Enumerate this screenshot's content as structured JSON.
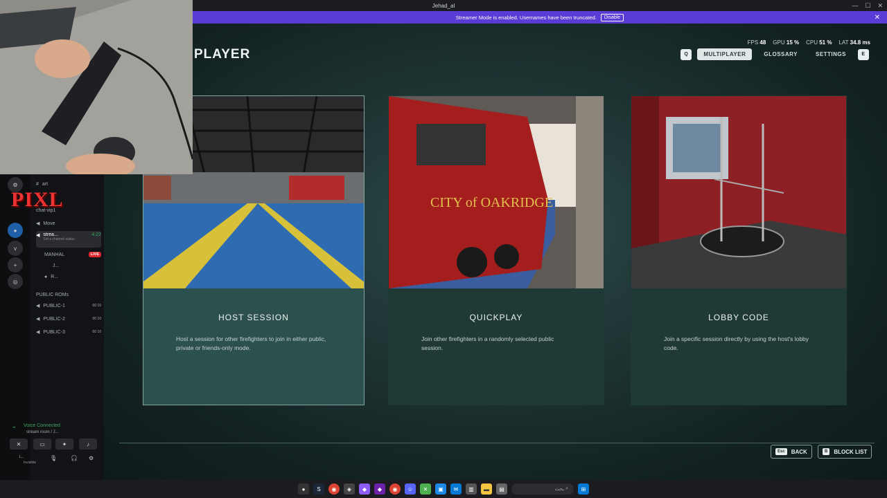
{
  "window": {
    "title": "Jehad_al"
  },
  "streamer_banner": {
    "text": "Streamer Mode is enabled. Usernames have been truncated.",
    "disable_label": "Disable",
    "close_label": "✕"
  },
  "game": {
    "title": "PLAYER",
    "stats": {
      "fps_label": "FPS",
      "fps": "48",
      "gpu_label": "GPU",
      "gpu": "15 %",
      "cpu_label": "CPU",
      "cpu": "51 %",
      "lat_label": "LAT",
      "lat": "34.8 ms"
    },
    "nav": {
      "left_key": "Q",
      "tabs": [
        "MULTIPLAYER",
        "GLOSSARY",
        "SETTINGS"
      ],
      "right_key": "E"
    },
    "cards": [
      {
        "title": "HOST SESSION",
        "desc": "Host a session for other firefighters to join in either public, private or friends-only mode."
      },
      {
        "title": "QUICKPLAY",
        "desc": "Join other firefighters in a randomly selected public session."
      },
      {
        "title": "LOBBY CODE",
        "desc": "Join a specific session directly by using the host's lobby code."
      }
    ],
    "bottom": {
      "back_key": "Esc",
      "back_label": "BACK",
      "block_key": "B",
      "block_label": "BLOCK LIST"
    }
  },
  "discord": {
    "logo_text": "PIXL",
    "channels": [
      {
        "icon": "#",
        "name": "art"
      },
      {
        "icon": "",
        "name": "chat-vip1"
      },
      {
        "icon": "🔊",
        "name": "Move"
      },
      {
        "icon": "🔊",
        "name": "strea...",
        "time": "4:22",
        "status": "Set a channel status"
      },
      {
        "icon": "",
        "name": "MANHAL",
        "badge": "LIVE"
      },
      {
        "icon": "",
        "name": "J..."
      },
      {
        "icon": "",
        "name": "R..."
      },
      {
        "icon": "",
        "name": "PUBLIC ROMs"
      },
      {
        "icon": "🔊",
        "name": "PUBLIC-1",
        "count": "00 10"
      },
      {
        "icon": "🔊",
        "name": "PUBLIC-2",
        "count": "00 10"
      },
      {
        "icon": "🔊",
        "name": "PUBLIC-3",
        "count": "00 10"
      }
    ],
    "voice": {
      "title": "Voice Connected",
      "room": "stream room / J...",
      "user": "i...",
      "status": "Invisible"
    }
  },
  "taskbar": {
    "search_placeholder": "بحث"
  }
}
